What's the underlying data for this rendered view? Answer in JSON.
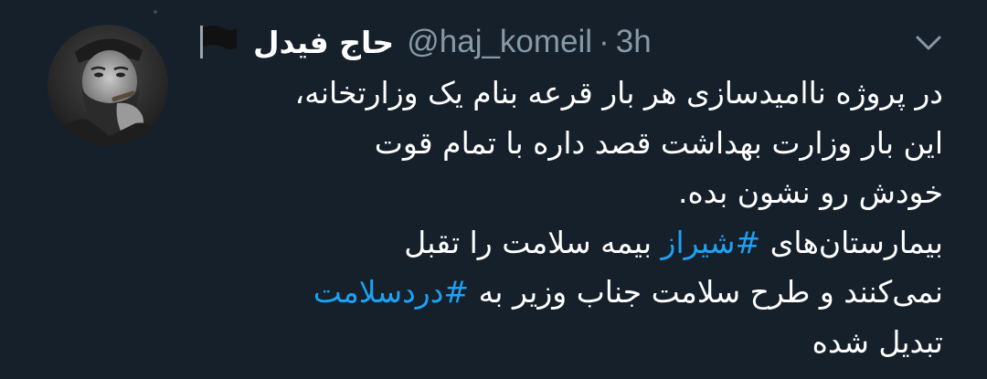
{
  "tweet": {
    "display_name": "حاج فیدل",
    "handle": "@haj_komeil",
    "separator": "·",
    "time": "3h",
    "flag_icon": "black-flag-icon",
    "menu_icon": "chevron-down-icon",
    "colors": {
      "background": "#15202b",
      "text": "#ffffff",
      "secondary": "#8899a6",
      "link": "#1da1f2"
    },
    "body": {
      "line1": "در پروژه ناامیدسازی هر بار قرعه بنام یک وزارتخانه،",
      "line2": "این بار وزارت بهداشت قصد داره با تمام قوت",
      "line3": "خودش رو نشون بده.",
      "line4_before": "بیمارستان‌های ",
      "hashtag1": "#شیراز",
      "line4_after": " بیمه سلامت را تقبل",
      "line5_before": "نمی‌کنند و طرح سلامت جناب وزیر به ",
      "hashtag2": "#دردسلامت",
      "line6": "تبدیل شده"
    }
  }
}
